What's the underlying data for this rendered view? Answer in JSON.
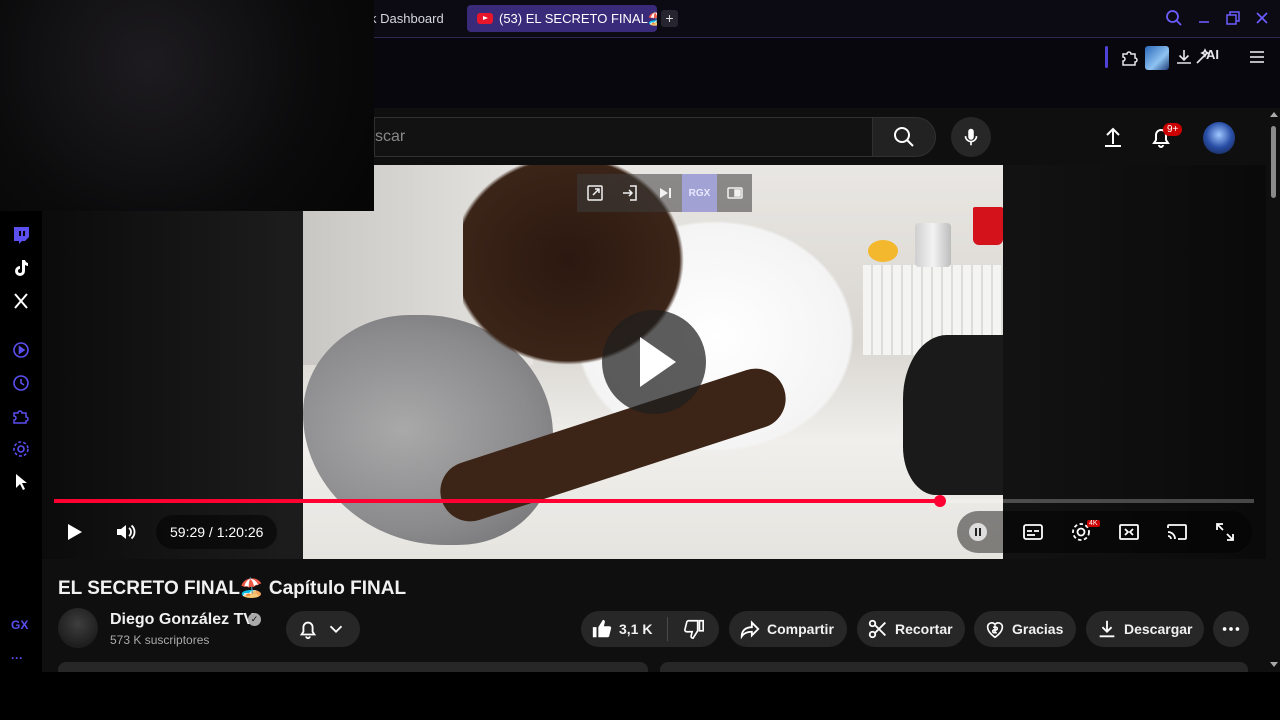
{
  "browser": {
    "tabs": [
      {
        "label": "k Dashboard",
        "active": false
      },
      {
        "label": "(53) EL SECRETO FINAL🏖️",
        "active": true
      }
    ],
    "new_tab": "+",
    "toolbar_ai_label": "AI",
    "accent_color": "#5b4ff0"
  },
  "youtube": {
    "search_placeholder": "scar",
    "notifications_badge": "9+",
    "player": {
      "time_current": "59:29",
      "time_total": "1:20:26",
      "time_display": "59:29 / 1:20:26",
      "progress_fraction": 0.738,
      "quality_badge": "4K",
      "extension_label": "RGX"
    },
    "video": {
      "title": "EL SECRETO FINAL🏖️ Capítulo FINAL",
      "channel_name": "Diego González TV",
      "verified_mark": "✓",
      "subscribers": "573 K suscriptores"
    },
    "actions": {
      "likes": "3,1 K",
      "share": "Compartir",
      "clip": "Recortar",
      "thanks": "Gracias",
      "download": "Descargar"
    }
  },
  "sidebar": {
    "items": [
      "twitch-icon",
      "tiktok-icon",
      "x-icon",
      "player-icon",
      "history-icon",
      "extensions-icon",
      "settings-icon",
      "pointer-icon"
    ],
    "gx_label": "GX",
    "more_label": "···"
  }
}
